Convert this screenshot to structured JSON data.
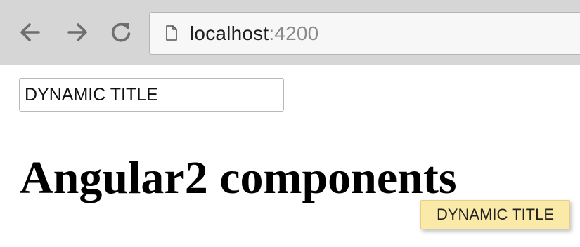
{
  "browser": {
    "url_host": "localhost",
    "url_port": ":4200",
    "icons": {
      "back": "arrow-left-icon",
      "forward": "arrow-right-icon",
      "reload": "reload-icon",
      "page": "page-icon"
    }
  },
  "form": {
    "title_value": "DYNAMIC TITLE"
  },
  "page": {
    "heading": "Angular2 components"
  },
  "tooltip": {
    "text": "DYNAMIC TITLE"
  },
  "colors": {
    "toolbar_bg": "#d6d6d6",
    "tooltip_bg": "#fbe9a8",
    "port_text": "#8a8a8a"
  }
}
